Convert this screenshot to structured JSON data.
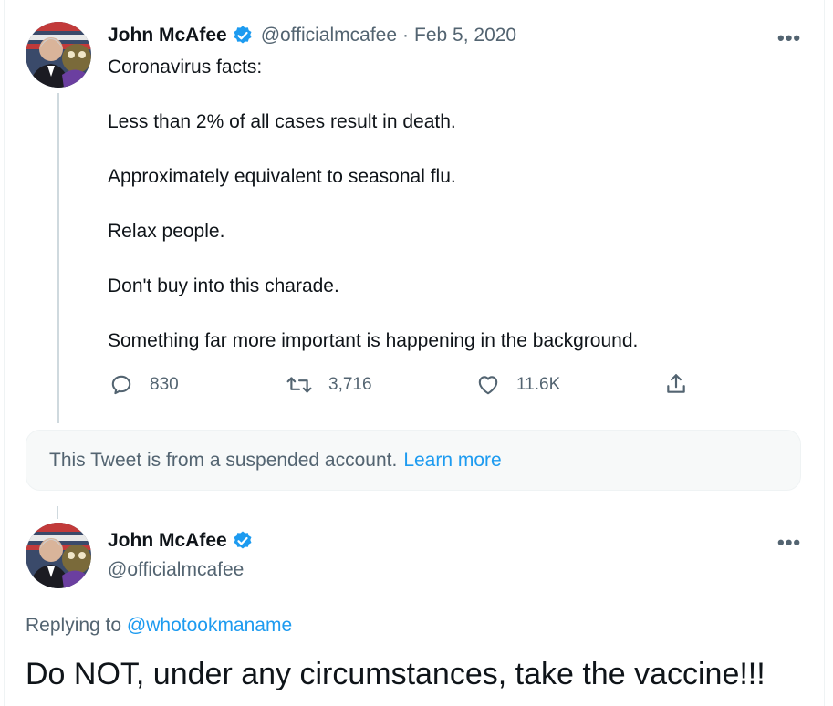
{
  "tweet1": {
    "author_name": "John McAfee",
    "handle": "@officialmcafee",
    "separator": "·",
    "date": "Feb 5, 2020",
    "more_label": "•••",
    "lines": [
      "Coronavirus facts:",
      "Less than 2% of all cases result in death.",
      "Approximately equivalent to seasonal flu.",
      "Relax people.",
      "Don't buy into this charade.",
      "Something far more important is happening in the background."
    ],
    "actions": {
      "replies": "830",
      "retweets": "3,716",
      "likes": "11.6K"
    }
  },
  "suspended_notice": {
    "text": "This Tweet is from a suspended account.",
    "link": "Learn more"
  },
  "tweet2": {
    "author_name": "John McAfee",
    "handle": "@officialmcafee",
    "more_label": "•••",
    "replying_prefix": "Replying to",
    "replying_to": "@whotookmaname",
    "text": "Do NOT, under any circumstances, take the vaccine!!!"
  },
  "colors": {
    "text_primary": "#0f1419",
    "text_secondary": "#536471",
    "link": "#1d9bf0",
    "verified": "#1d9bf0",
    "thread_line": "#cfd9de"
  },
  "icons": [
    "verified-badge-icon",
    "more-icon",
    "reply-icon",
    "retweet-icon",
    "like-icon",
    "share-icon"
  ]
}
